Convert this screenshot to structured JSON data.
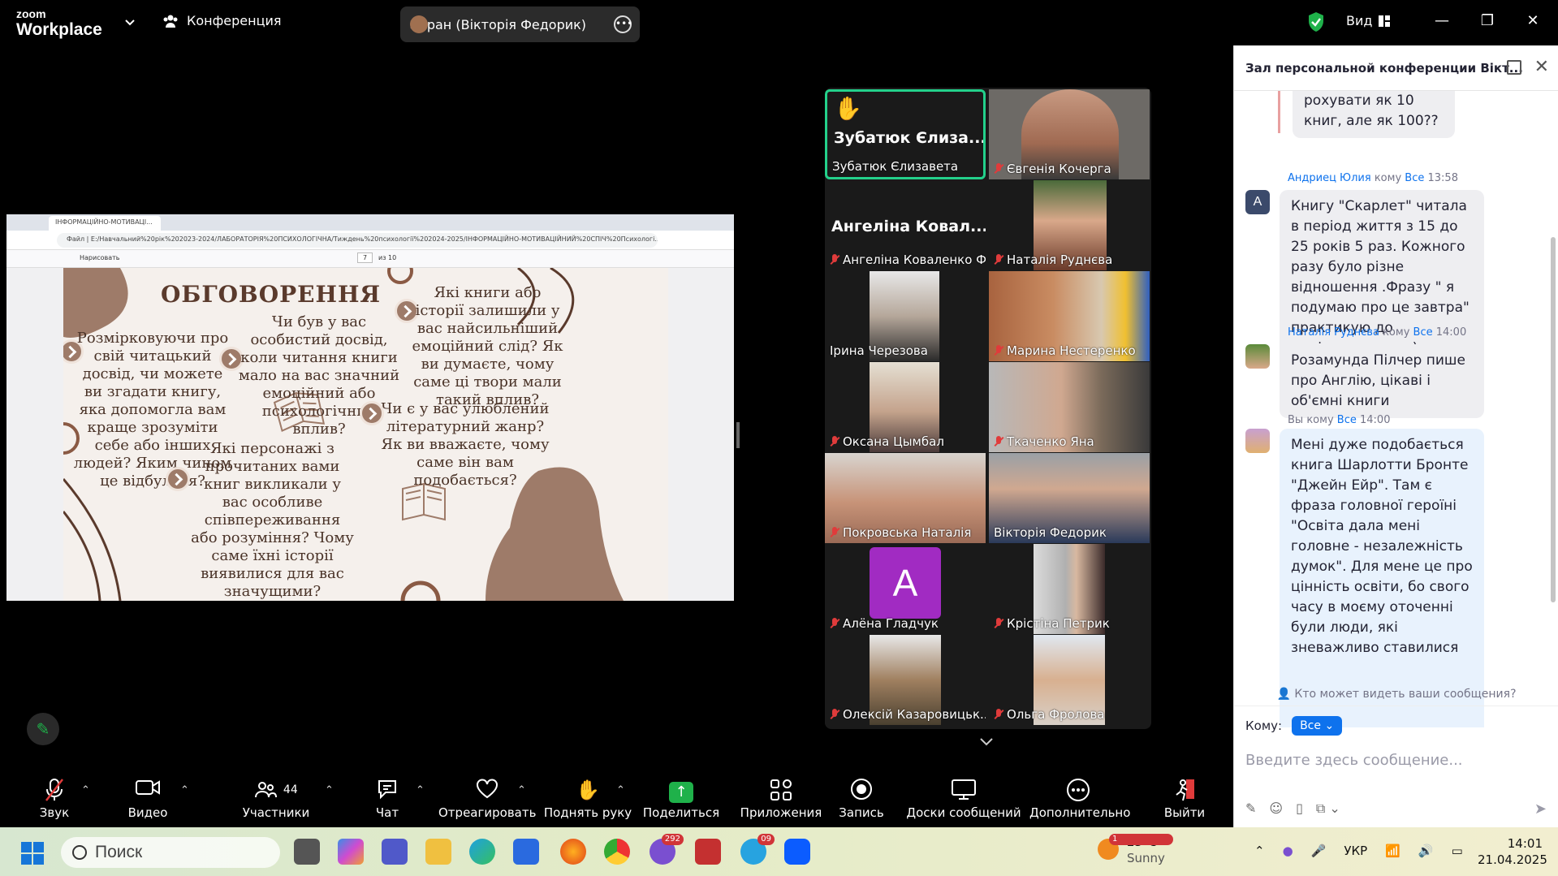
{
  "topbar": {
    "logo_line1": "zoom",
    "logo_line2": "Workplace",
    "conference_label": "Конференция",
    "share_label": "Экран (Вікторія Федорик)",
    "view_label": "Вид"
  },
  "shared_screen": {
    "tab_title": "ІНФОРМАЦІЙНО-МОТИВАЦІ...",
    "url_prefix": "Файл",
    "url": "E:/Навчальний%20рік%202023-2024/ЛАБОРАТОРІЯ%20ПСИХОЛОГІЧНА/Тиждень%20психології%202024-2025/ІНФОРМАЦІЙНО-МОТИВАЦІЙНИЙ%20СПІЧ%20Психологі...",
    "draw_label": "Нарисовать",
    "page_num": "7",
    "page_total": "из 10",
    "slide": {
      "title": "ОБГОВОРЕННЯ",
      "q1": "Розмірковуючи про свій читацький досвід, чи можете ви згадати книгу, яка допомогла вам краще зрозуміти себе або інших людей? Яким чином це відбулося?",
      "q2": "Чи був у вас особистий досвід, коли читання книги мало на вас значний емоційний або психологічний вплив?",
      "q3": "Які книги або історії залишили у вас найсильніший емоційний слід? Як ви думаєте, чому саме ці твори мали такий вплив?",
      "q4": "Чи є у вас улюблений літературний жанр? Як ви вважаєте, чому саме він вам подобається?",
      "q5": "Які персонажі з прочитаних вами книг викликали у вас особливе співпереживання або розуміння? Чому саме їхні історії виявилися для вас значущими?"
    }
  },
  "participants": [
    {
      "name": "Зубатюк Єлизавета",
      "big": "Зубатюк Єлиза...",
      "hand": true,
      "muted": false,
      "active": true
    },
    {
      "name": "Євгенія Кочерга",
      "muted": true
    },
    {
      "name": "Ангеліна Коваленко Ф...",
      "big": "Ангеліна Ковал...",
      "muted": true
    },
    {
      "name": "Наталія Руднєва",
      "muted": true
    },
    {
      "name": "Ірина Черезова",
      "muted": false
    },
    {
      "name": "Марина Нестеренко",
      "muted": true
    },
    {
      "name": "Оксана Цымбал",
      "muted": true
    },
    {
      "name": "Ткаченко Яна",
      "muted": true
    },
    {
      "name": "Покровська Наталія",
      "muted": true
    },
    {
      "name": "Вікторія Федорик",
      "muted": false
    },
    {
      "name": "Алёна Гладчук",
      "initial": "A",
      "muted": true
    },
    {
      "name": "Крістіна Петрик",
      "muted": true
    },
    {
      "name": "Олексій Казаровицьк...",
      "muted": true
    },
    {
      "name": "Ольга Фролова",
      "muted": true
    }
  ],
  "chat": {
    "title": "Зал персональной конференции Вікт...",
    "messages": [
      {
        "text": "рохувати як 10 книг, але як 100??"
      },
      {
        "sender": "Андриец Юлия",
        "to_word": "кому",
        "to": "Все",
        "time": "13:58",
        "avatar": "A",
        "text": "Книгу \"Скарлет\" читала в період життя з 15 до 25 років 5 раз. Кожного разу було різне відношення .Фразу \" я подумаю про це завтра\" практикую до нинішнього часу)"
      },
      {
        "sender": "Наталія Руднєва",
        "to_word": "кому",
        "to": "Все",
        "time": "14:00",
        "text": "Розамунда Пілчер пише про Англію, цікаві і об'ємні книги"
      },
      {
        "sender": "Вы",
        "to_word": "кому",
        "to": "Все",
        "time": "14:00",
        "text": "Мені дуже подобається книга Шарлотти Бронте \"Джейн Ейр\". Там є фраза головної героїні \"Освіта дала мені головне - незалежність думок\". Для мене це про цінність освіти, бо свого часу в моєму оточенні були люди, які зневажливо ставилися"
      }
    ],
    "who_can_see": "Кто может видеть ваши сообщения?",
    "to_label": "Кому:",
    "to_value": "Все",
    "input_placeholder": "Введите здесь сообщение..."
  },
  "toolbar": {
    "sound": "Звук",
    "video": "Видео",
    "participants": "Участники",
    "participants_count": "44",
    "chat": "Чат",
    "react": "Отреагировать",
    "raise_hand": "Поднять руку",
    "share": "Поделиться",
    "apps": "Приложения",
    "record": "Запись",
    "whiteboards": "Доски сообщений",
    "more": "Дополнительно",
    "leave": "Выйти"
  },
  "taskbar": {
    "search": "Поиск",
    "viber_badge": "292",
    "telegram_badge": "09",
    "weather_temp": "23°C",
    "weather_desc": "Sunny",
    "weather_badge": "1",
    "lang": "УКР",
    "time": "14:01",
    "date": "21.04.2025"
  },
  "colors": {
    "accent": "#0e72ed",
    "green": "#1fb14a",
    "muted_red": "#e03b3b",
    "active_border": "#23d18b"
  }
}
